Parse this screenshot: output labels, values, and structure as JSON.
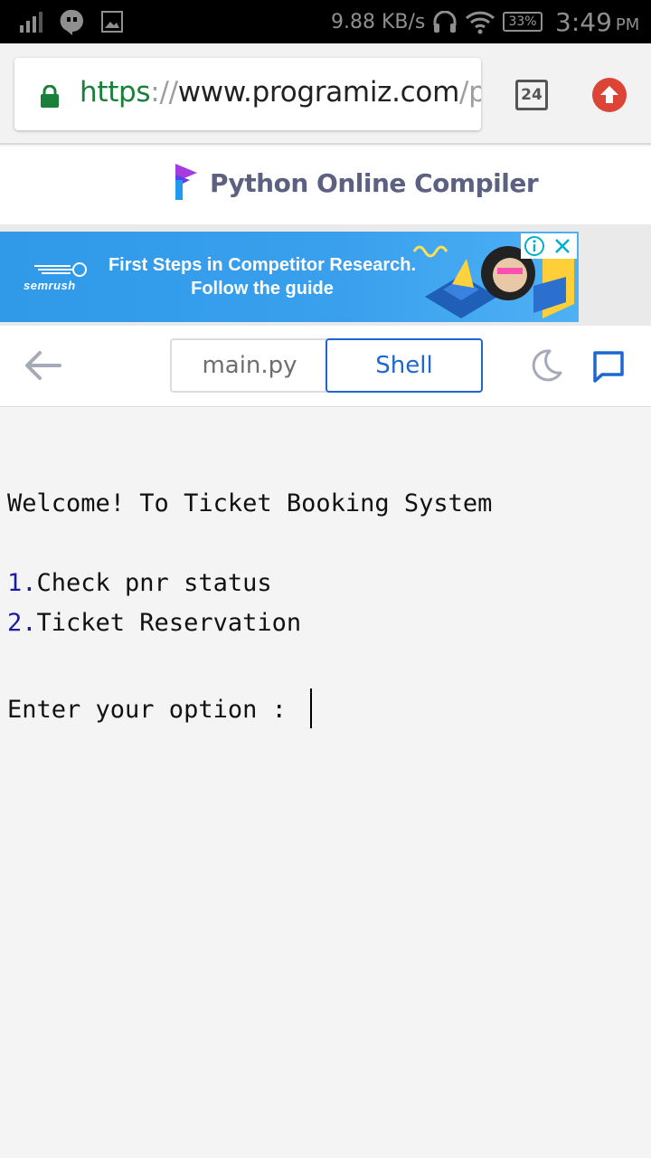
{
  "status_bar": {
    "network_speed": "9.88 KB/s",
    "battery": "33%",
    "time": "3:49",
    "ampm": "PM"
  },
  "browser": {
    "url_protocol": "https",
    "url_separator": "://",
    "url_host": "www.programiz.com",
    "url_path": "/p",
    "tab_count": "24"
  },
  "site": {
    "title": "Python Online Compiler"
  },
  "ad": {
    "brand": "semrush",
    "line1": "First Steps in Competitor Research.",
    "line2": "Follow the guide"
  },
  "toolbar": {
    "tabs": [
      {
        "label": "main.py",
        "active": false
      },
      {
        "label": "Shell",
        "active": true
      }
    ]
  },
  "console": {
    "welcome": "Welcome! To Ticket Booking System",
    "options": [
      {
        "num": "1.",
        "text": "Check pnr status"
      },
      {
        "num": "2.",
        "text": "Ticket Reservation"
      }
    ],
    "prompt": "Enter your option : "
  },
  "colors": {
    "accent": "#1f66d1",
    "secure_green": "#188038",
    "ad_blue": "#3aa0ee",
    "update_red": "#db4437"
  }
}
